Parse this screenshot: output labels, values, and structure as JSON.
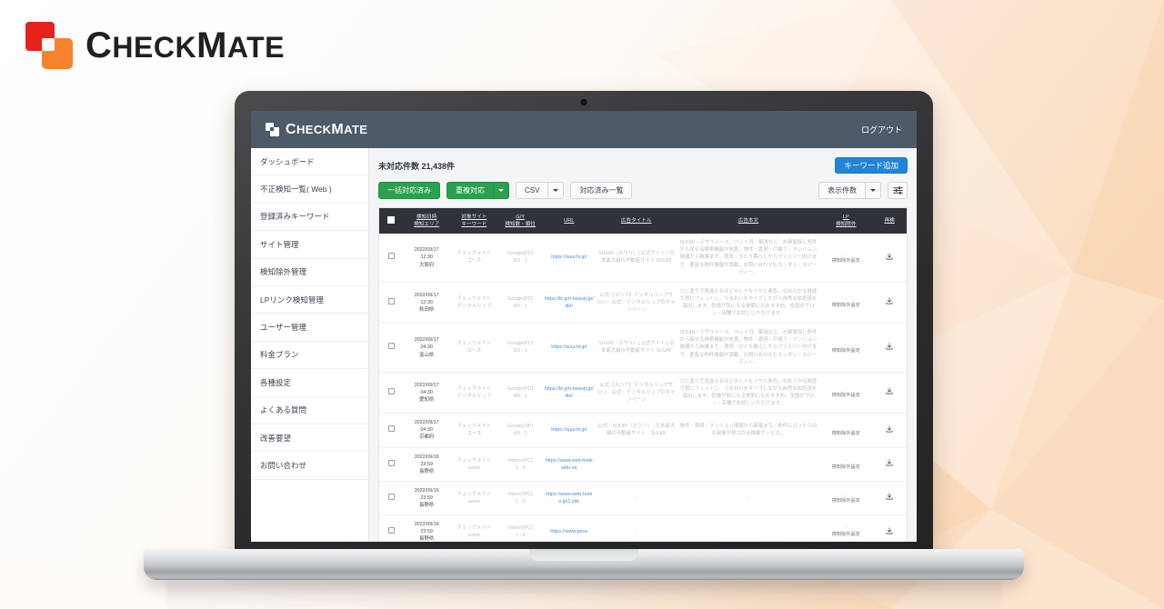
{
  "brand": {
    "name_first": "C",
    "name_check": "HECK",
    "name_m": "M",
    "name_ate": "ATE"
  },
  "app_header": {
    "logo_first": "C",
    "logo_check": "HECK",
    "logo_m": "M",
    "logo_ate": "ATE",
    "logout_label": "ログアウト"
  },
  "sidebar": {
    "items": [
      {
        "label": "ダッシュボード"
      },
      {
        "label": "不正検知一覧( Web )"
      },
      {
        "label": "登録済みキーワード"
      },
      {
        "label": "サイト管理"
      },
      {
        "label": "検知除外管理"
      },
      {
        "label": "LPリンク検知管理"
      },
      {
        "label": "ユーザー管理"
      },
      {
        "label": "料金プラン"
      },
      {
        "label": "各種設定"
      },
      {
        "label": "よくある質問"
      },
      {
        "label": "改善要望"
      },
      {
        "label": "お問い合わせ"
      }
    ]
  },
  "toolbar": {
    "count_label": "未対応件数 21,438件",
    "add_keyword_label": "キーワード追加",
    "bulk_done_label": "一括対応済み",
    "duplicate_label": "重複対応",
    "csv_label": "CSV",
    "done_list_label": "対応済み一覧",
    "display_count_label": "表示件数",
    "filter_icon": "sliders-icon",
    "accent_blue": "#2284d8",
    "accent_green": "#2aa14c"
  },
  "table": {
    "headers": {
      "check": "",
      "datetime_l1": "検知日時",
      "datetime_l2": "検知エリア",
      "site_l1": "対象サイト",
      "site_l2": "キーワード",
      "gy_l1": "G/Y",
      "gy_l2": "検知数・順位",
      "url": "URL",
      "ad_title": "広告タイトル",
      "ad_body": "広告本文",
      "lp_l1": "LP",
      "lp_l2": "検知除外",
      "image": "再検"
    },
    "exclude_link_label": "検知除外設定",
    "download_icon": "download-icon",
    "rows": [
      {
        "date": "2022/09/17",
        "time": "12:30",
        "area": "大阪府",
        "site": "チェックメイト",
        "keyword": "コース",
        "engine": "Google(PC)",
        "rank": "5/2 - 1",
        "url": "https://suuchi.jp/",
        "ad_title": "SUURI（スウリ）| 公式サイト | 日本最大級の不動産サイト SUURI",
        "ad_body": "SUURI・デザイナーズ、ペット可、築浅など、お部屋探し条件から探せる検索機能が充実。物件・賃貸・戸建て・マンション情報から新築まで。賃貸・ひとり暮らしからファミリー向けまで、豊富な物件情報が満載。お問い合わせもカンタン・スピーディー。",
        "exclude": "検知除外設定"
      },
      {
        "date": "2022/09/17",
        "time": "12:30",
        "area": "秋田県",
        "site": "チェックメイト",
        "keyword": "デンタルリップ",
        "engine": "Google(PC)",
        "rank": "4/0 - 1",
        "url": "https://lit.gm-beauty.jp/lite/",
        "ad_title": "公式【スハク】デンタルリップサロン - 公式｜デンタルリップのキャンペーン",
        "ad_body": "ひと塗りで見違えるほどキレイなツヤと発色。なめらかな質感で唇にフィットし、うるおいをキープしながら自然な血色感を演出します。乾燥が気になる季節にもおすすめ。全国のサロン・店舗でお試しいただけます。",
        "exclude": "検知除外設定"
      },
      {
        "date": "2022/09/17",
        "time": "04:30",
        "area": "富山県",
        "site": "チェックメイト",
        "keyword": "コース",
        "engine": "Google(PC)",
        "rank": "5/2 - 1",
        "url": "https://suuchi.jp/",
        "ad_title": "SUURI（スウリ）| 公式サイト | 日本最大級の不動産サイト SUURI",
        "ad_body": "SUURI・デザイナーズ、ペット可、築浅など、お部屋探し条件から探せる検索機能が充実。物件・賃貸・戸建て・マンション情報から新築まで。賃貸・ひとり暮らしからファミリー向けまで、豊富な物件情報が満載。お問い合わせもカンタン・スピーディー。",
        "exclude": "検知除外設定"
      },
      {
        "date": "2022/09/17",
        "time": "04:30",
        "area": "愛知県",
        "site": "チェックメイト",
        "keyword": "デンタルリップ",
        "engine": "Google(PC)",
        "rank": "4/0 - 1",
        "url": "https://lit.gm-beauty.jp/lite/",
        "ad_title": "公式【スハク】デンタルリップサロン - 公式｜デンタルリップのキャンペーン",
        "ad_body": "ひと塗りで見違えるほどキレイなツヤと発色。なめらかな質感で唇にフィットし、うるおいをキープしながら自然な血色感を演出します。乾燥が気になる季節にもおすすめ。全国のサロン・店舗でお試しいただけます。",
        "exclude": "検知除外設定"
      },
      {
        "date": "2022/09/17",
        "time": "04:30",
        "area": "京都府",
        "site": "チェックメイト",
        "keyword": "コース",
        "engine": "Google(SP)",
        "rank": "4/0 - 1",
        "url": "https://suuchi.jp/",
        "ad_title": "公式｜SUURI（スウリ）- 日本最大級の不動産サイト｜SUURI",
        "ad_body": "物件・賃貸・マンション情報から新築まで。条件にぴったりのお部屋が見つかる検索サービス。",
        "exclude": "検知除外設定"
      },
      {
        "date": "2022/09/16",
        "time": "23:59",
        "area": "長野県",
        "site": "チェックメイト",
        "keyword": "sumo",
        "engine": "Yahoo!(PC)",
        "rank": "1 - 0",
        "url": "https://www.web-hokkaido.ne",
        "ad_title": "-",
        "ad_body": "-",
        "exclude": "検知除外設定"
      },
      {
        "date": "2022/09/16",
        "time": "23:59",
        "area": "長野県",
        "site": "チェックメイト",
        "keyword": "sumo",
        "engine": "Yahoo!(PC)",
        "rank": "1 - 0",
        "url": "https://www.web-home.jp/1.site",
        "ad_title": "-",
        "ad_body": "-",
        "exclude": "検知除外設定"
      },
      {
        "date": "2022/09/16",
        "time": "23:59",
        "area": "長野県",
        "site": "チェックメイト",
        "keyword": "sumo",
        "engine": "Yahoo!(PC)",
        "rank": "1 - 0",
        "url": "https://www.price",
        "ad_title": "-",
        "ad_body": "",
        "exclude": "検知除外設定"
      }
    ]
  }
}
